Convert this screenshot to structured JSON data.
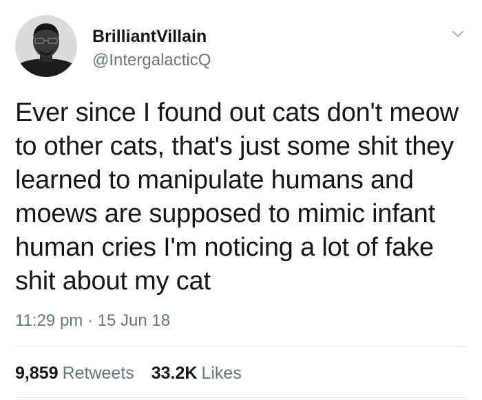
{
  "user": {
    "display_name": "BrilliantVillain",
    "handle": "@IntergalacticQ",
    "avatar_icon": "profile-photo"
  },
  "tweet": {
    "text": "Ever since I found out cats don't meow to other cats, that's just some shit they learned to manipulate humans and moews are supposed to mimic infant human cries I'm noticing a lot of fake shit about my cat",
    "timestamp": "11:29 pm · 15 Jun 18"
  },
  "stats": {
    "retweets_count": "9,859",
    "retweets_label": "Retweets",
    "likes_count": "33.2K",
    "likes_label": "Likes"
  },
  "menu": {
    "icon": "chevron-down-icon"
  },
  "colors": {
    "text_primary": "#14171a",
    "text_secondary": "#657786",
    "divider": "#e1e8ed",
    "chevron": "#aab8c2"
  }
}
